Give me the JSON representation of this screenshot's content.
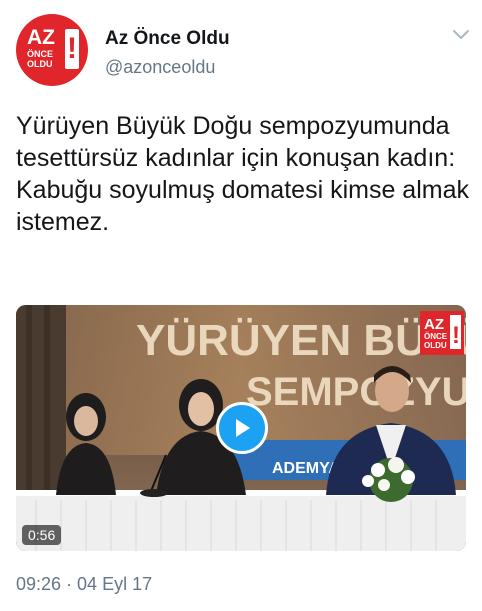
{
  "account": {
    "name": "Az Önce Oldu",
    "handle": "@azonceoldu",
    "logo_main": "AZ",
    "logo_sub_1": "ÖNCE",
    "logo_sub_2": "OLDU",
    "logo_mark": "!",
    "brand_color": "#e0262b"
  },
  "tweet": {
    "text": "Yürüyen Büyük Doğu sempozyumunda tesettürsüz kadınlar için konuşan kadın: Kabuğu soyulmuş domatesi kimse almak istemez.",
    "timestamp": "09:26 · 04 Eyl 17"
  },
  "media": {
    "banner_line1": "YÜRÜYEN BÜYÜK",
    "banner_line2": "SEMPOZYUMU",
    "banner_fragment": "ADEMYA",
    "watermark_main": "AZ",
    "watermark_sub_1": "ÖNCE",
    "watermark_sub_2": "OLDU",
    "watermark_mark": "!",
    "duration": "0:56",
    "accent_color": "#1da1f2"
  },
  "icons": {
    "menu": "chevron-down-icon",
    "play": "play-icon"
  }
}
